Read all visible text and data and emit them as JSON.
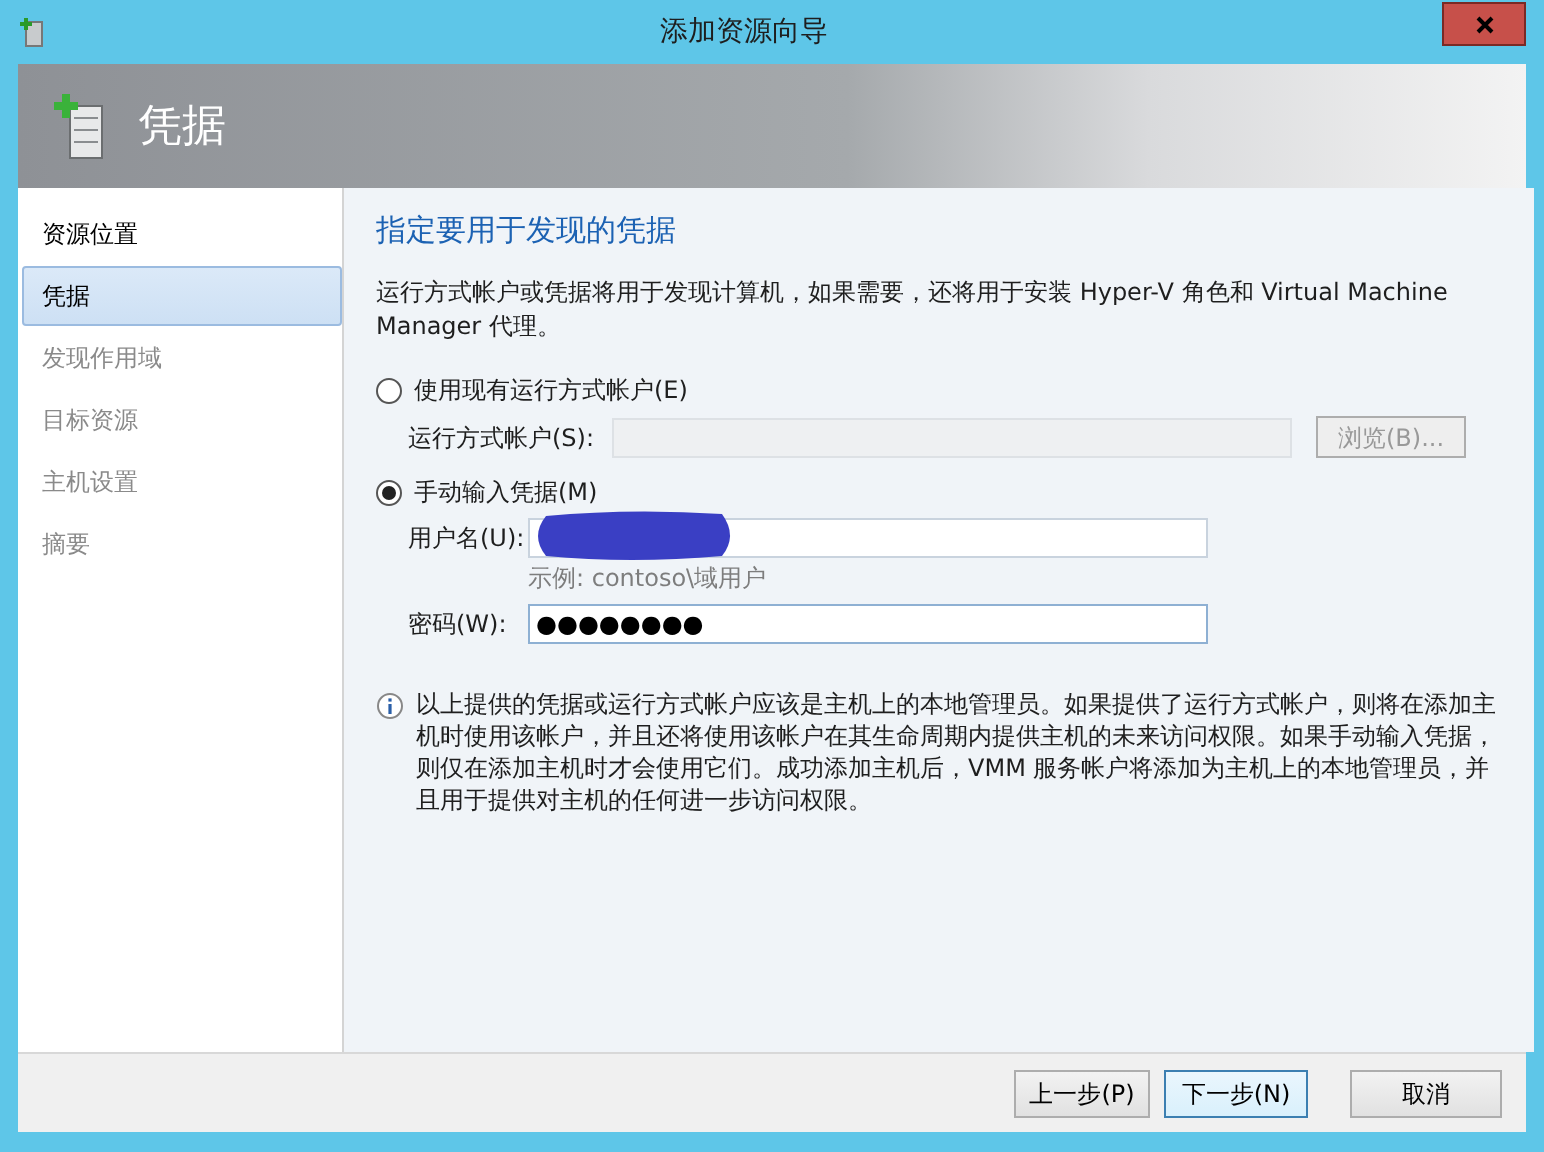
{
  "window": {
    "title": "添加资源向导"
  },
  "header": {
    "title": "凭据"
  },
  "sidebar": {
    "items": [
      {
        "label": "资源位置",
        "selected": false,
        "disabled": false
      },
      {
        "label": "凭据",
        "selected": true,
        "disabled": false
      },
      {
        "label": "发现作用域",
        "selected": false,
        "disabled": true
      },
      {
        "label": "目标资源",
        "selected": false,
        "disabled": true
      },
      {
        "label": "主机设置",
        "selected": false,
        "disabled": true
      },
      {
        "label": "摘要",
        "selected": false,
        "disabled": true
      }
    ]
  },
  "content": {
    "heading": "指定要用于发现的凭据",
    "description": "运行方式帐户或凭据将用于发现计算机，如果需要，还将用于安装 Hyper-V 角色和 Virtual Machine Manager 代理。",
    "options": [
      {
        "label": "使用现有运行方式帐户(E)",
        "selected": false
      },
      {
        "label": "手动输入凭据(M)",
        "selected": true
      }
    ],
    "run_as_account": {
      "label": "运行方式帐户(S):",
      "disabled": true,
      "browse_button": "浏览(B)..."
    },
    "username": {
      "label": "用户名(U):",
      "redacted": true,
      "hint": "示例: contoso\\域用户"
    },
    "password": {
      "label": "密码(W):",
      "value": "●●●●●●●●"
    },
    "info": "以上提供的凭据或运行方式帐户应该是主机上的本地管理员。如果提供了运行方式帐户，则将在添加主机时使用该帐户，并且还将使用该帐户在其生命周期内提供主机的未来访问权限。如果手动输入凭据，则仅在添加主机时才会使用它们。成功添加主机后，VMM 服务帐户将添加为主机上的本地管理员，并且用于提供对主机的任何进一步访问权限。"
  },
  "buttons": [
    {
      "label": "上一步(P)",
      "focused": false
    },
    {
      "label": "下一步(N)",
      "focused": true
    },
    {
      "label": "取消",
      "focused": false
    }
  ]
}
